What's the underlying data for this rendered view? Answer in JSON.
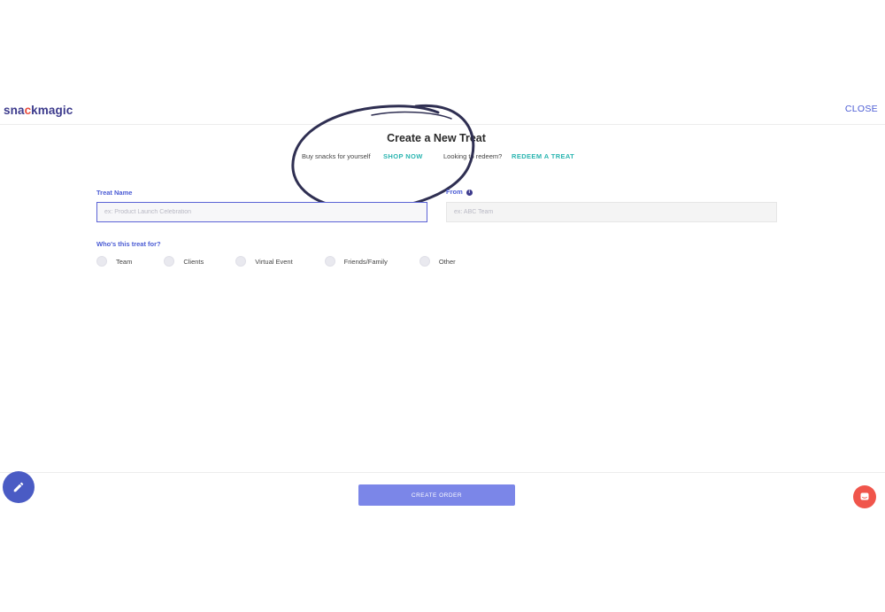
{
  "header": {
    "logo_prefix": "sna",
    "logo_dot": "c",
    "logo_suffix": "kmagic",
    "close_label": "CLOSE"
  },
  "hero": {
    "title": "Create a New Treat",
    "buy_text": "Buy snacks for yourself",
    "shop_link": "SHOP NOW",
    "redeem_text": "Looking to redeem?",
    "redeem_link": "REDEEM A TREAT"
  },
  "form": {
    "treat_name_label": "Treat Name",
    "treat_name_placeholder": "ex: Product Launch Celebration",
    "treat_name_value": "",
    "from_label": "From",
    "from_placeholder": "ex: ABC Team",
    "from_value": "",
    "audience_label": "Who's this treat for?",
    "audience_options": [
      "Team",
      "Clients",
      "Virtual Event",
      "Friends/Family",
      "Other"
    ]
  },
  "footer": {
    "create_label": "CREATE ORDER"
  },
  "icons": {
    "info": "info-icon",
    "edit": "pencil-icon",
    "chat": "chat-icon"
  },
  "colors": {
    "brand": "#3c3a8c",
    "accent": "#4a5bd4",
    "teal": "#2ab5b0",
    "button": "#7b86e8",
    "chat": "#f0554b"
  }
}
